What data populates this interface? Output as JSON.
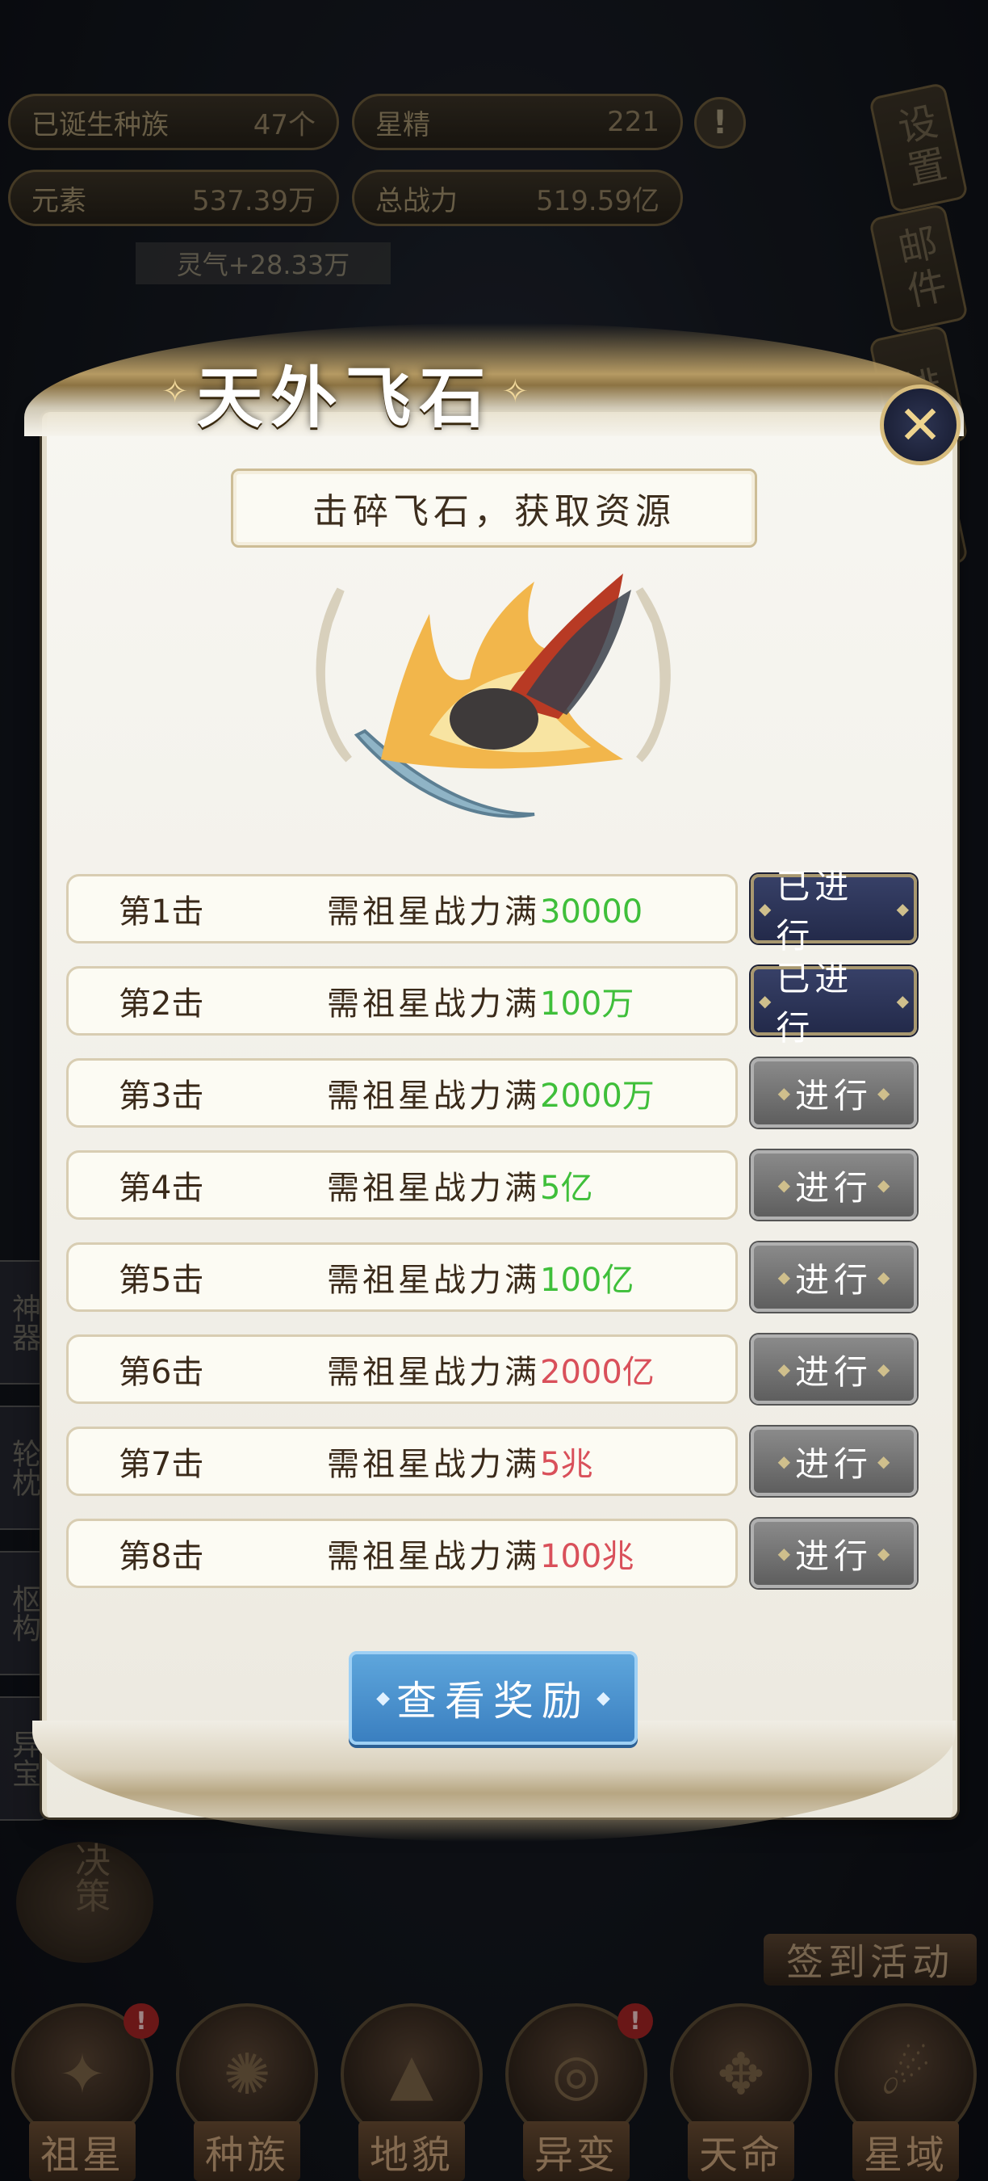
{
  "hud": {
    "born_races_label": "已诞生种族",
    "born_races_value": "47个",
    "star_essence_label": "星精",
    "star_essence_value": "221",
    "element_label": "元素",
    "element_value": "537.39万",
    "total_power_label": "总战力",
    "total_power_value": "519.59亿",
    "lingqi": "灵气+28.33万",
    "warn": "!"
  },
  "side_menu": [
    "设置",
    "邮件",
    "排",
    "示"
  ],
  "left_tabs": [
    "神器",
    "轮枕",
    "枢构",
    "异宝"
  ],
  "decide_label": "决策",
  "signin_label": "签到活动",
  "nav": [
    {
      "label": "祖星",
      "icon": "ancestor-star-icon",
      "badge": "!"
    },
    {
      "label": "种族",
      "icon": "race-icon",
      "badge": ""
    },
    {
      "label": "地貌",
      "icon": "terrain-icon",
      "badge": ""
    },
    {
      "label": "异变",
      "icon": "mutation-icon",
      "badge": "!"
    },
    {
      "label": "天命",
      "icon": "destiny-icon",
      "badge": ""
    },
    {
      "label": "星域",
      "icon": "star-domain-icon",
      "badge": ""
    }
  ],
  "modal": {
    "title": "天外飞石",
    "subtitle": "击碎飞石，获取资源",
    "requirement_prefix": "需祖星战力满",
    "reward_button": "查看奖励",
    "close_icon": "close-icon",
    "colors": {
      "green": "#3fbf3a",
      "red": "#d9505a",
      "done_button": "#2a3154",
      "todo_button": "#707070",
      "reward_button": "#4a90cf"
    },
    "strikes": [
      {
        "label": "第1击",
        "value": "30000",
        "color": "#3fbf3a",
        "button": "已进行",
        "done": true
      },
      {
        "label": "第2击",
        "value": "100万",
        "color": "#3fbf3a",
        "button": "已进行",
        "done": true
      },
      {
        "label": "第3击",
        "value": "2000万",
        "color": "#3fbf3a",
        "button": "进行",
        "done": false
      },
      {
        "label": "第4击",
        "value": "5亿",
        "color": "#3fbf3a",
        "button": "进行",
        "done": false
      },
      {
        "label": "第5击",
        "value": "100亿",
        "color": "#3fbf3a",
        "button": "进行",
        "done": false
      },
      {
        "label": "第6击",
        "value": "2000亿",
        "color": "#d9505a",
        "button": "进行",
        "done": false
      },
      {
        "label": "第7击",
        "value": "5兆",
        "color": "#d9505a",
        "button": "进行",
        "done": false
      },
      {
        "label": "第8击",
        "value": "100兆",
        "color": "#d9505a",
        "button": "进行",
        "done": false
      }
    ]
  }
}
